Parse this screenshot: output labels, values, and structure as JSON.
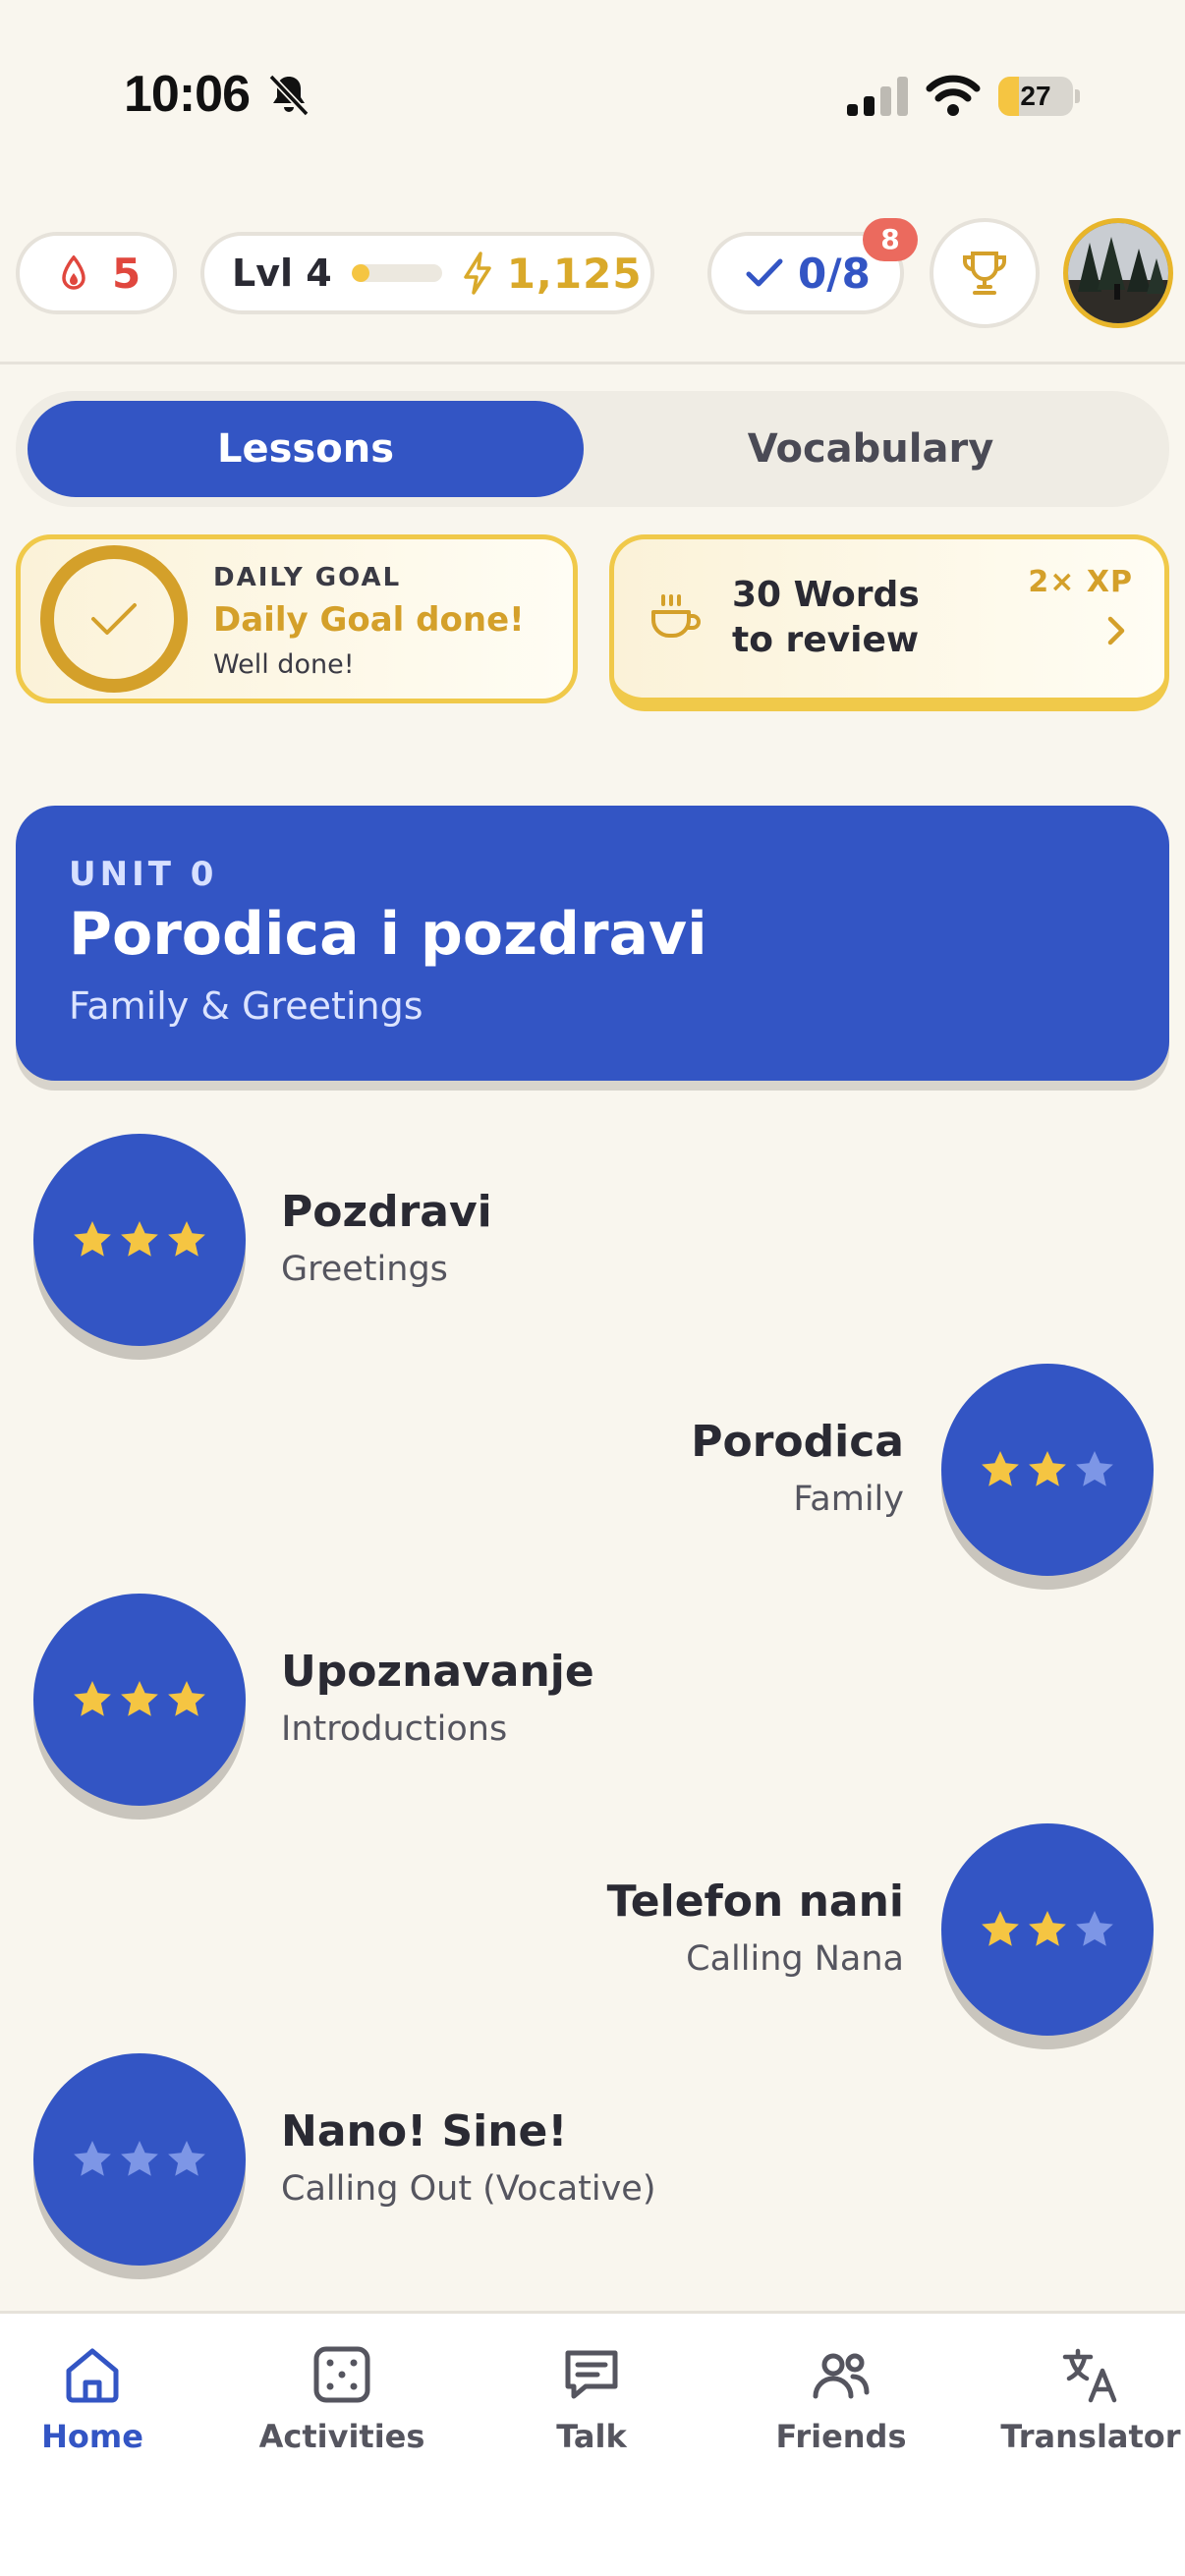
{
  "status_bar": {
    "time": "10:06",
    "battery_level": "27",
    "battery_fraction": 0.27
  },
  "top_stats": {
    "streak": "5",
    "level_label": "Lvl 4",
    "level_progress": 0.2,
    "xp": "1,125",
    "tasks": "0/8",
    "tasks_badge": "8"
  },
  "tabs": [
    {
      "label": "Lessons",
      "active": true
    },
    {
      "label": "Vocabulary",
      "active": false
    }
  ],
  "daily_goal": {
    "kicker": "DAILY GOAL",
    "title": "Daily Goal done!",
    "subtitle": "Well done!"
  },
  "review": {
    "line1": "30 Words",
    "line2": "to review",
    "bonus": "2× XP"
  },
  "unit": {
    "kicker": "UNIT 0",
    "title": "Porodica i pozdravi",
    "subtitle": "Family & Greetings"
  },
  "lessons": [
    {
      "title": "Pozdravi",
      "subtitle": "Greetings",
      "stars": 3
    },
    {
      "title": "Porodica",
      "subtitle": "Family",
      "stars": 2
    },
    {
      "title": "Upoznavanje",
      "subtitle": "Introductions",
      "stars": 3
    },
    {
      "title": "Telefon nani",
      "subtitle": "Calling Nana",
      "stars": 2
    },
    {
      "title": "Nano! Sine!",
      "subtitle": "Calling Out (Vocative)",
      "stars": 0
    }
  ],
  "nav": [
    {
      "label": "Home",
      "icon": "home-icon",
      "active": true
    },
    {
      "label": "Activities",
      "icon": "dice-icon",
      "active": false
    },
    {
      "label": "Talk",
      "icon": "chat-icon",
      "active": false
    },
    {
      "label": "Friends",
      "icon": "friends-icon",
      "active": false
    },
    {
      "label": "Translator",
      "icon": "translate-icon",
      "active": false
    }
  ],
  "colors": {
    "primary": "#3355C4",
    "gold": "#D4A02A",
    "star_filled": "#F5C542",
    "star_empty": "#7D96E6",
    "streak_red": "#E0473E",
    "badge_red": "#EB6A5E",
    "background": "#F9F6EE"
  }
}
